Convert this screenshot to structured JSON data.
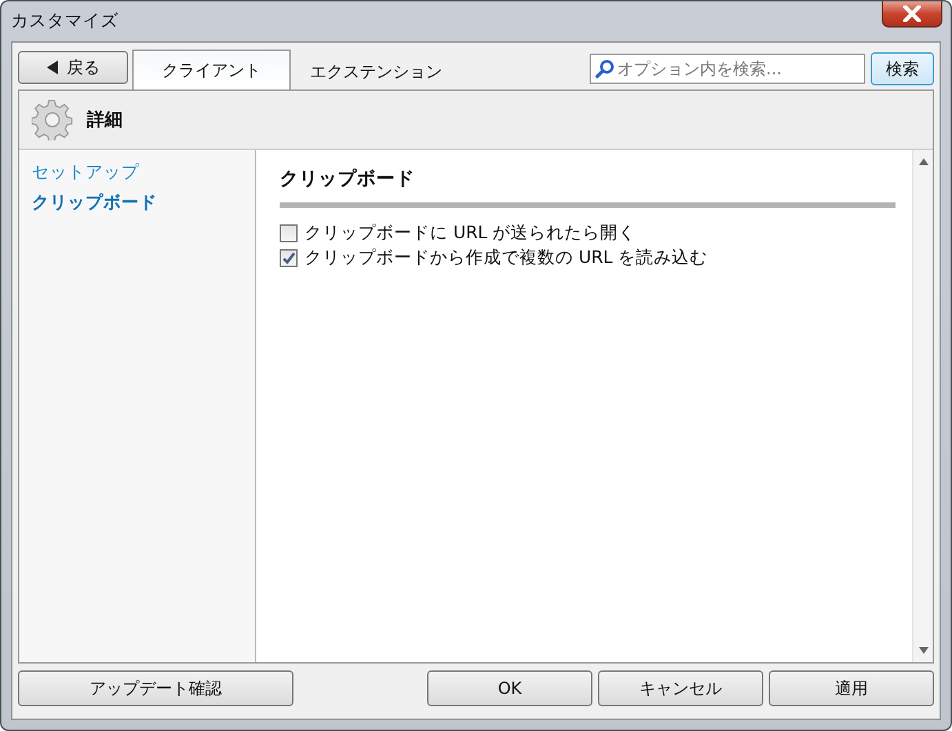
{
  "window": {
    "title": "カスタマイズ"
  },
  "back_button": {
    "label": "戻る"
  },
  "tabs": [
    {
      "label": "クライアント",
      "selected": true
    },
    {
      "label": "エクステンション",
      "selected": false
    }
  ],
  "search": {
    "placeholder": "オプション内を検索...",
    "button": "検索"
  },
  "section_header": {
    "title": "詳細"
  },
  "sidebar": {
    "items": [
      {
        "label": "セットアップ",
        "selected": false
      },
      {
        "label": "クリップボード",
        "selected": true
      }
    ]
  },
  "content": {
    "heading": "クリップボード",
    "options": [
      {
        "label": "クリップボードに URL が送られたら開く",
        "checked": false
      },
      {
        "label": "クリップボードから作成で複数の URL を読み込む",
        "checked": true
      }
    ]
  },
  "footer": {
    "left_button": "アップデート確認",
    "buttons": [
      "OK",
      "キャンセル",
      "適用"
    ]
  }
}
